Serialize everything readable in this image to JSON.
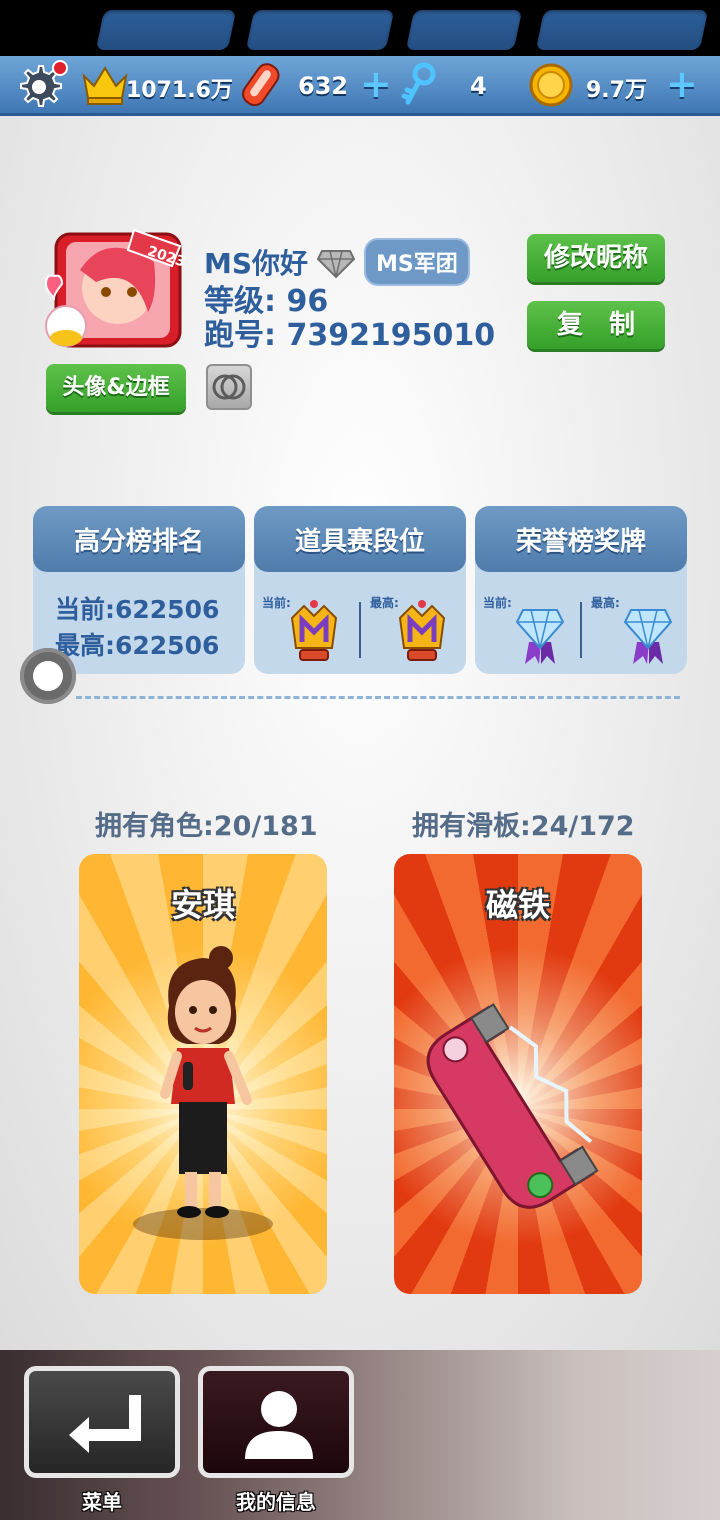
{
  "resources": {
    "trophies": "1071.6万",
    "hoverboards": "632",
    "keys": "4",
    "coins": "9.7万"
  },
  "profile": {
    "name": "MS你好",
    "team": "MS军团",
    "level": "等级: 96",
    "run_id": "跑号: 7392195010",
    "avatar_year": "2023",
    "rename_button": "修改昵称",
    "copy_button": "复　制",
    "avatar_frame_button": "头像&边框"
  },
  "stats": {
    "highscore": {
      "title": "高分榜排名",
      "current": "当前:622506",
      "best": "最高:622506"
    },
    "item_rank": {
      "title": "道具赛段位",
      "current_label": "当前:",
      "best_label": "最高:"
    },
    "honor": {
      "title": "荣誉榜奖牌",
      "current_label": "当前:",
      "best_label": "最高:"
    }
  },
  "owned": {
    "characters": "拥有角色:20/181",
    "boards": "拥有滑板:24/172",
    "character_name": "安琪",
    "board_name": "磁铁"
  },
  "nav": {
    "menu": "菜单",
    "my_info": "我的信息"
  },
  "colors": {
    "topbar": "#4f86c2",
    "accent_blue": "#2f5e9d",
    "green_button": "#42aa32"
  }
}
